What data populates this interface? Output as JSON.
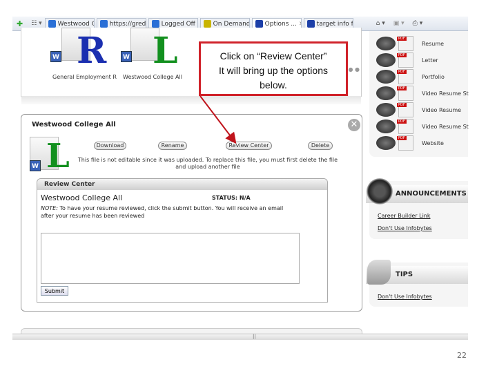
{
  "browser": {
    "tabs": [
      {
        "label": "Westwood C...",
        "color": "#2a6fd6"
      },
      {
        "label": "https://gred....",
        "color": "#2a6fd6"
      },
      {
        "label": "Logged Off",
        "color": "#2a6fd6"
      },
      {
        "label": "On Demand -",
        "color": "#c9b400"
      },
      {
        "label": "Options ...",
        "color": "#1c3fa8"
      },
      {
        "label": "target info for...",
        "color": "#1c3fa8"
      }
    ]
  },
  "documents": [
    {
      "letter": "R",
      "caption": "General Employment R",
      "color": "#1b2fb0"
    },
    {
      "letter": "L",
      "caption": "Westwood College All",
      "color": "#13901f"
    }
  ],
  "callout": {
    "line1": "Click on “Review Center”",
    "line2": "It will bring up the options",
    "line3": "below.",
    "color": "#d0222a"
  },
  "modal": {
    "title": "Westwood College All",
    "letter": "L",
    "buttons": {
      "download": "Download",
      "rename": "Rename",
      "review": "Review Center",
      "delete": "Delete"
    },
    "notice": "This file is not editable since it was uploaded. To replace this file, you must first delete the file and upload another file",
    "review_center": {
      "header": "Review Center",
      "doc_title": "Westwood College All",
      "status": "STATUS: N/A",
      "note_label": "NOTE:",
      "note": " To have your resume reviewed, click the submit button. You will receive an email after your resume has been reviewed",
      "submit": "Submit"
    }
  },
  "sidebar": {
    "items": [
      "Resume",
      "Letter",
      "Portfolio",
      "Video Resume St",
      "Video Resume",
      "Video Resume St",
      "Website"
    ],
    "announcements": {
      "title": "ANNOUNCEMENTS",
      "links": [
        "Career Builder Link",
        "Don't Use Infobytes"
      ]
    },
    "tips": {
      "title": "TIPS",
      "links": [
        "Don't Use Infobytes"
      ]
    }
  },
  "page_number": "22"
}
